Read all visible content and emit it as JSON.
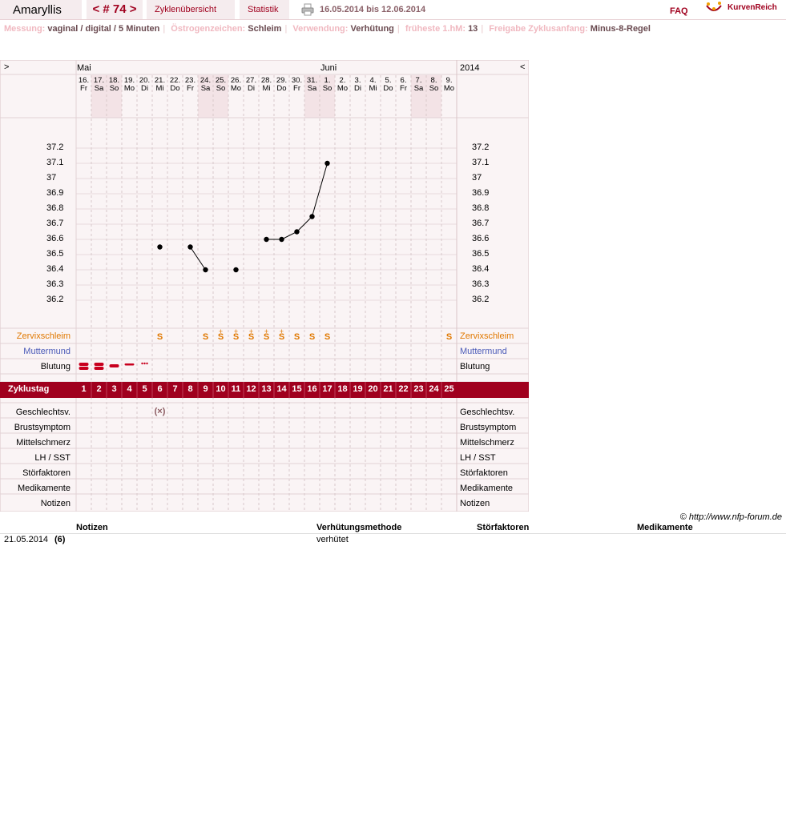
{
  "header": {
    "user_name": "Amaryllis",
    "cycle_nav": "< # 74 >",
    "tab_overview": "Zyklenübersicht",
    "tab_stats": "Statistik",
    "date_range": "16.05.2014 bis 12.06.2014",
    "faq": "FAQ",
    "logo_text": "KurvenReich"
  },
  "info": [
    {
      "label": "Messung:",
      "value": "vaginal / digital / 5 Minuten"
    },
    {
      "label": "Östrogenzeichen:",
      "value": "Schleim"
    },
    {
      "label": "Verwendung:",
      "value": "Verhütung"
    },
    {
      "label": "früheste 1.hM:",
      "value": "13"
    },
    {
      "label": "Freigabe Zyklusanfang:",
      "value": "Minus-8-Regel"
    }
  ],
  "chart": {
    "nav_prev": ">",
    "nav_next": "<",
    "month_may": "Mai",
    "month_june": "Juni",
    "year": "2014",
    "days": [
      {
        "d": "16.",
        "w": "Fr",
        "weekend": false
      },
      {
        "d": "17.",
        "w": "Sa",
        "weekend": true
      },
      {
        "d": "18.",
        "w": "So",
        "weekend": true
      },
      {
        "d": "19.",
        "w": "Mo",
        "weekend": false
      },
      {
        "d": "20.",
        "w": "Di",
        "weekend": false
      },
      {
        "d": "21.",
        "w": "Mi",
        "weekend": false
      },
      {
        "d": "22.",
        "w": "Do",
        "weekend": false
      },
      {
        "d": "23.",
        "w": "Fr",
        "weekend": false
      },
      {
        "d": "24.",
        "w": "Sa",
        "weekend": true
      },
      {
        "d": "25.",
        "w": "So",
        "weekend": true
      },
      {
        "d": "26.",
        "w": "Mo",
        "weekend": false
      },
      {
        "d": "27.",
        "w": "Di",
        "weekend": false
      },
      {
        "d": "28.",
        "w": "Mi",
        "weekend": false
      },
      {
        "d": "29.",
        "w": "Do",
        "weekend": false
      },
      {
        "d": "30.",
        "w": "Fr",
        "weekend": false
      },
      {
        "d": "31.",
        "w": "Sa",
        "weekend": true
      },
      {
        "d": "1.",
        "w": "So",
        "weekend": true
      },
      {
        "d": "2.",
        "w": "Mo",
        "weekend": false
      },
      {
        "d": "3.",
        "w": "Di",
        "weekend": false
      },
      {
        "d": "4.",
        "w": "Mi",
        "weekend": false
      },
      {
        "d": "5.",
        "w": "Do",
        "weekend": false
      },
      {
        "d": "6.",
        "w": "Fr",
        "weekend": false
      },
      {
        "d": "7.",
        "w": "Sa",
        "weekend": true
      },
      {
        "d": "8.",
        "w": "So",
        "weekend": true
      },
      {
        "d": "9.",
        "w": "Mo",
        "weekend": false
      }
    ],
    "temp_ticks": [
      "37.2",
      "37.1",
      "37",
      "36.9",
      "36.8",
      "36.7",
      "36.6",
      "36.5",
      "36.4",
      "36.3",
      "36.2"
    ],
    "row_labels": {
      "cervix": "Zervixschleim",
      "cervix_os": "Muttermund",
      "bleeding": "Blutung",
      "cycle_day": "Zyklustag",
      "intercourse": "Geschlechtsv.",
      "breast": "Brustsymptom",
      "mittelschmerz": "Mittelschmerz",
      "lh": "LH / SST",
      "disturbance": "Störfaktoren",
      "medication": "Medikamente",
      "notes": "Notizen"
    },
    "cycle_days": [
      "1",
      "2",
      "3",
      "4",
      "5",
      "6",
      "7",
      "8",
      "9",
      "10",
      "11",
      "12",
      "13",
      "14",
      "15",
      "16",
      "17",
      "18",
      "19",
      "20",
      "21",
      "22",
      "23",
      "24",
      "25"
    ],
    "mucus": [
      {
        "day": 6,
        "mark": "S",
        "plus": ""
      },
      {
        "day": 9,
        "mark": "S",
        "plus": ""
      },
      {
        "day": 10,
        "mark": "S",
        "plus": "+"
      },
      {
        "day": 11,
        "mark": "S",
        "plus": "+"
      },
      {
        "day": 12,
        "mark": "S",
        "plus": "+"
      },
      {
        "day": 13,
        "mark": "S",
        "plus": "+"
      },
      {
        "day": 14,
        "mark": "S",
        "plus": "+"
      },
      {
        "day": 15,
        "mark": "S",
        "plus": ""
      },
      {
        "day": 16,
        "mark": "S",
        "plus": ""
      },
      {
        "day": 17,
        "mark": "S",
        "plus": ""
      },
      {
        "day": 25,
        "mark": "S",
        "plus": ""
      }
    ],
    "bleeding": [
      {
        "day": 1,
        "level": "heavy"
      },
      {
        "day": 2,
        "level": "heavy"
      },
      {
        "day": 3,
        "level": "medium"
      },
      {
        "day": 4,
        "level": "light"
      },
      {
        "day": 5,
        "level": "spotting"
      }
    ],
    "intercourse": [
      {
        "day": 6,
        "mark": "(×)"
      }
    ],
    "colors": {
      "accent": "#a0001e",
      "mucus": "#e07800",
      "cervix_os": "#4a5ab8",
      "weekend": "#f3e3e6",
      "grid_bg": "#faf4f5"
    }
  },
  "chart_data": {
    "type": "line",
    "title": "",
    "xlabel": "",
    "ylabel": "",
    "ylim": [
      36.1,
      37.3
    ],
    "series": [
      {
        "points": [
          {
            "cycle_day": 6,
            "temp": 36.55
          },
          {
            "cycle_day": 8,
            "temp": 36.55
          },
          {
            "cycle_day": 9,
            "temp": 36.4
          },
          {
            "cycle_day": 11,
            "temp": 36.4
          },
          {
            "cycle_day": 13,
            "temp": 36.6
          },
          {
            "cycle_day": 14,
            "temp": 36.6
          },
          {
            "cycle_day": 15,
            "temp": 36.65
          },
          {
            "cycle_day": 16,
            "temp": 36.75
          },
          {
            "cycle_day": 17,
            "temp": 37.1
          }
        ],
        "segments": [
          [
            8,
            9
          ],
          [
            13,
            14,
            15,
            16,
            17
          ]
        ]
      }
    ]
  },
  "notes": {
    "col_notes": "Notizen",
    "col_method": "Verhütungsmethode",
    "col_disturbance": "Störfaktoren",
    "col_medication": "Medikamente",
    "copyright": "© http://www.nfp-forum.de",
    "rows": [
      {
        "date": "21.05.2014",
        "day": "(6)",
        "method": "verhütet"
      }
    ]
  }
}
